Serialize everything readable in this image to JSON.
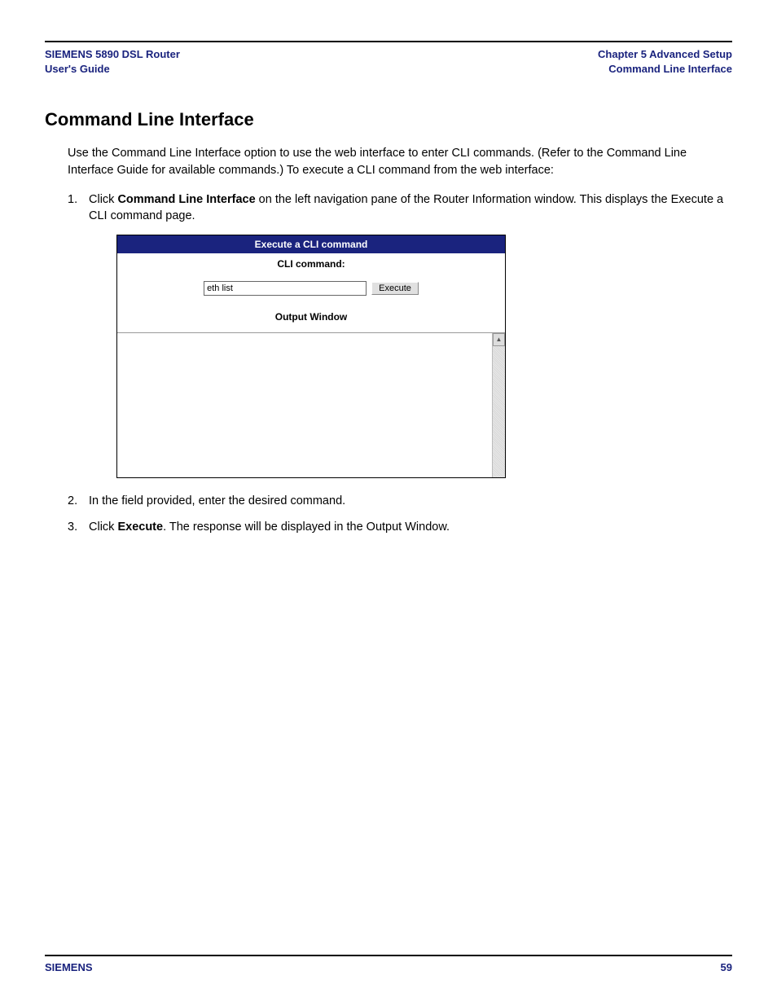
{
  "header": {
    "left_line1": "SIEMENS 5890 DSL Router",
    "left_line2": "User's Guide",
    "right_line1": "Chapter 5  Advanced Setup",
    "right_line2": "Command Line Interface"
  },
  "title": "Command Line Interface",
  "intro": "Use the Command Line Interface option to use the web interface to enter CLI commands. (Refer to the Command Line Interface Guide for available commands.) To execute a CLI command from the web interface:",
  "steps": {
    "s1_num": "1.",
    "s1_pre": "Click ",
    "s1_bold": "Command Line Interface",
    "s1_post": " on the left navigation pane of the Router Information window. This displays the Execute a CLI command page.",
    "s2_num": "2.",
    "s2_text": "In the field provided, enter the desired command.",
    "s3_num": "3.",
    "s3_pre": "Click ",
    "s3_bold": "Execute",
    "s3_post": ". The response will be displayed in the Output Window."
  },
  "screenshot": {
    "title": "Execute a CLI command",
    "cli_label": "CLI command:",
    "input_value": "eth list",
    "execute_btn": "Execute",
    "output_label": "Output Window"
  },
  "footer": {
    "left": "SIEMENS",
    "right": "59"
  }
}
